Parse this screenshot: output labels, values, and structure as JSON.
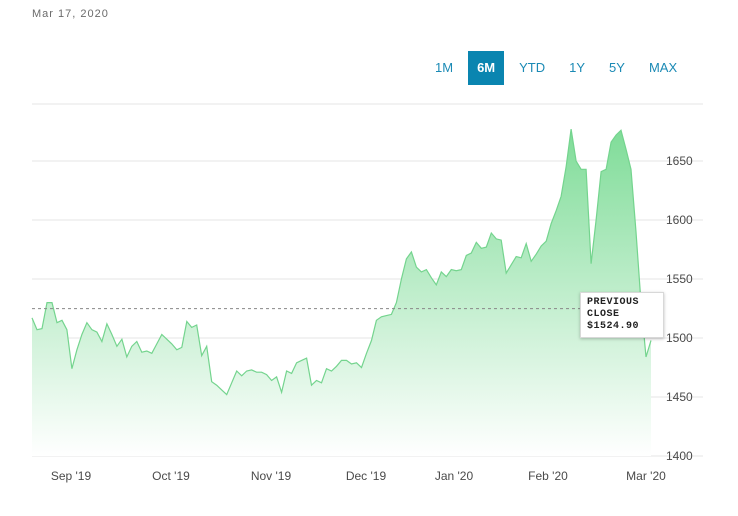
{
  "header": {
    "date": "Mar 17, 2020"
  },
  "range_buttons": [
    {
      "label": "1M",
      "active": false
    },
    {
      "label": "6M",
      "active": true
    },
    {
      "label": "YTD",
      "active": false
    },
    {
      "label": "1Y",
      "active": false
    },
    {
      "label": "5Y",
      "active": false
    },
    {
      "label": "MAX",
      "active": false
    }
  ],
  "previous_close": {
    "label_line1": "PREVIOUS",
    "label_line2": "CLOSE",
    "value_text": "$1524.90",
    "value": 1524.9
  },
  "colors": {
    "area_top": "#7fdc98",
    "area_bottom": "#ffffff",
    "line": "#74d48e",
    "accent": "#0a85b0"
  },
  "chart_data": {
    "type": "area",
    "title": "",
    "xlabel": "",
    "ylabel": "",
    "ylim": [
      1400,
      1690
    ],
    "yticks": [
      1400,
      1450,
      1500,
      1550,
      1600,
      1650
    ],
    "xticks": [
      "Sep '19",
      "Oct '19",
      "Nov '19",
      "Dec '19",
      "Jan '20",
      "Feb '20",
      "Mar '20"
    ],
    "grid": true,
    "series": [
      {
        "values": [
          1517,
          1507,
          1508,
          1530,
          1530,
          1513,
          1515,
          1507,
          1474,
          1490,
          1503,
          1513,
          1507,
          1505,
          1497,
          1512,
          1503,
          1493,
          1499,
          1484,
          1493,
          1497,
          1488,
          1489,
          1487,
          1495,
          1503,
          1499,
          1495,
          1490,
          1492,
          1514,
          1509,
          1511,
          1485,
          1493,
          1463,
          1460,
          1456,
          1452,
          1462,
          1472,
          1468,
          1472,
          1473,
          1471,
          1471,
          1469,
          1464,
          1467,
          1454,
          1472,
          1470,
          1479,
          1481,
          1483,
          1460,
          1464,
          1462,
          1474,
          1472,
          1476,
          1481,
          1481,
          1478,
          1479,
          1475,
          1487,
          1498,
          1515,
          1518,
          1519,
          1520,
          1530,
          1550,
          1567,
          1573,
          1560,
          1556,
          1558,
          1551,
          1545,
          1556,
          1552,
          1558,
          1557,
          1558,
          1570,
          1572,
          1581,
          1576,
          1577,
          1589,
          1584,
          1583,
          1555,
          1562,
          1569,
          1568,
          1580,
          1565,
          1571,
          1578,
          1582,
          1597,
          1608,
          1620,
          1645,
          1677,
          1650,
          1643,
          1643,
          1563,
          1600,
          1641,
          1643,
          1666,
          1672,
          1676,
          1660,
          1643,
          1590,
          1530,
          1484,
          1498
        ]
      }
    ]
  }
}
